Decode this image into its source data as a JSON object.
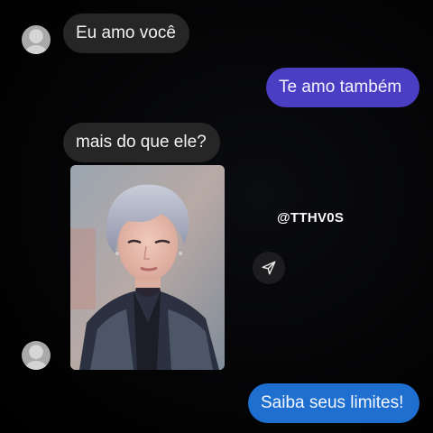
{
  "messages": [
    {
      "sender": "other",
      "text": "Eu amo você"
    },
    {
      "sender": "me",
      "text": "Te amo também"
    },
    {
      "sender": "other",
      "text": "mais do que ele?"
    },
    {
      "sender": "me",
      "text": "Saiba seus limites!"
    }
  ],
  "watermark": "@TTHV0S",
  "icons": {
    "avatar": "avatar-icon",
    "share": "send-icon"
  },
  "colors": {
    "incoming_bubble": "#262626",
    "outgoing_bubble_1": "#4a3ec3",
    "outgoing_bubble_2": "#1f6fd0",
    "background": "#020203"
  }
}
